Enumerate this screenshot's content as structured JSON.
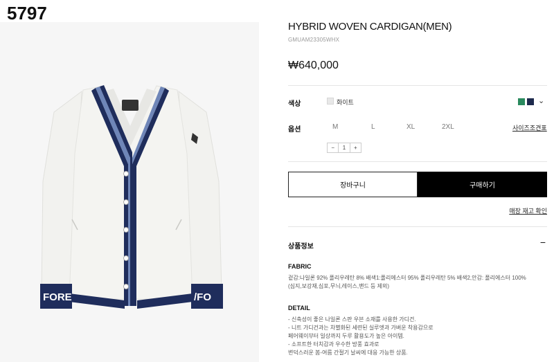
{
  "tag": "5797",
  "product": {
    "title": "HYBRID WOVEN CARDIGAN(MEN)",
    "sku": "GMUAM23305WHX",
    "price": "₩640,000"
  },
  "image": {
    "logo_text": "FORE",
    "colors": {
      "body": "#f2f2ef",
      "trim_navy": "#1f2d5c",
      "trim_blue": "#6f86b8"
    }
  },
  "options": {
    "color_label": "색상",
    "color_name": "화이트",
    "swatches": [
      {
        "name": "green",
        "hex": "#2a8a5e"
      },
      {
        "name": "navy",
        "hex": "#1d2a4d"
      }
    ],
    "size_label": "옵션",
    "sizes": [
      "M",
      "L",
      "XL",
      "2XL"
    ],
    "size_guide": "사이즈조견표",
    "quantity": {
      "minus": "−",
      "value": "1",
      "plus": "+"
    }
  },
  "actions": {
    "cart": "장바구니",
    "buy": "구매하기",
    "stock_link": "매장 재고 확인"
  },
  "info": {
    "title": "상품정보",
    "toggle": "−",
    "fabric_title": "FABRIC",
    "fabric_lines": [
      "겉감:나일론 92% 폴리우레탄 8% 배색1:폴리에스터 95% 폴리우레탄 5% 배색2,안감: 폴리에스터 100%",
      "(심지,보강재,심포,무늬,레이스,밴드 등 제외)"
    ],
    "detail_title": "DETAIL",
    "detail_lines": [
      "- 신축성이 좋은 나일론 스판 우븐 소재를 사용한 가디건.",
      "- 니트 가디건과는 차별화된 세련된 실루엣과 가벼운 착용감으로",
      "  페어웨이부터 일상까지 두루 활용도가 높은 아이템.",
      "- 소프트한 터치감과 우수한 방풍 효과로",
      "  변덕스러운 봄-여름 간절기 날씨에 대응 가능한 상품."
    ]
  }
}
